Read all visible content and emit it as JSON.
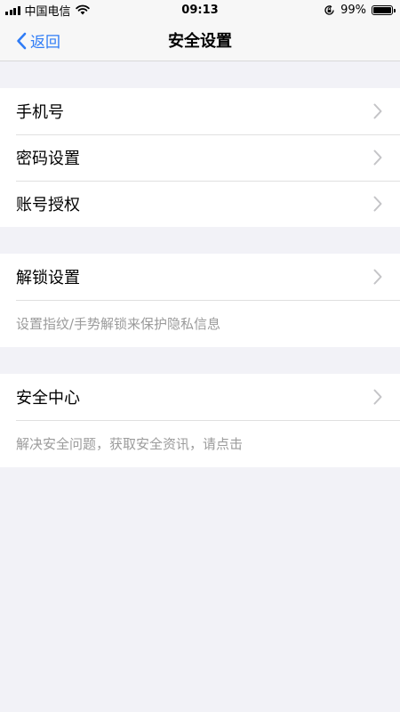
{
  "status_bar": {
    "carrier": "中国电信",
    "time": "09:13",
    "battery_percent": "99%",
    "battery_level": 0.99
  },
  "nav": {
    "back_label": "返回",
    "title": "安全设置"
  },
  "sections": [
    {
      "items": [
        {
          "label": "手机号"
        },
        {
          "label": "密码设置"
        },
        {
          "label": "账号授权"
        }
      ]
    },
    {
      "items": [
        {
          "label": "解锁设置"
        }
      ],
      "hint": "设置指纹/手势解锁来保护隐私信息"
    },
    {
      "items": [
        {
          "label": "安全中心"
        }
      ],
      "hint": "解决安全问题，获取安全资讯，请点击"
    }
  ],
  "colors": {
    "accent": "#2f7cf6",
    "background": "#f2f2f7",
    "hint_text": "#9b9b9b",
    "chevron": "#c4c4c7"
  },
  "icons": {
    "back": "chevron-left-icon",
    "disclosure": "chevron-right-icon",
    "wifi": "wifi-icon",
    "orientation_lock": "orientation-lock-icon",
    "battery": "battery-icon"
  }
}
